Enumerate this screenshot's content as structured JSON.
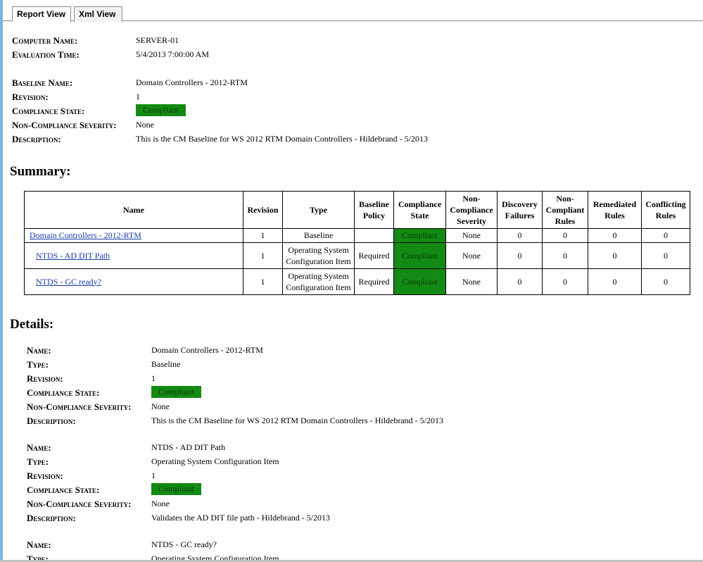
{
  "tabs": [
    {
      "label": "Report View"
    },
    {
      "label": "Xml View"
    }
  ],
  "header": {
    "computer_name_label": "Computer Name:",
    "computer_name": "SERVER-01",
    "evaluation_time_label": "Evaluation Time:",
    "evaluation_time": "5/4/2013 7:00:00 AM"
  },
  "baseline": {
    "name_label": "Baseline Name:",
    "name": "Domain Controllers - 2012-RTM",
    "revision_label": "Revision:",
    "revision": "1",
    "state_label": "Compliance State:",
    "state": "Compliant",
    "severity_label": "Non-Compliance Severity:",
    "severity": "None",
    "description_label": "Description:",
    "description": "This is the CM Baseline for WS 2012 RTM Domain Controllers - Hildebrand - 5/2013"
  },
  "summary": {
    "heading": "Summary:",
    "columns": [
      "Name",
      "Revision",
      "Type",
      "Baseline Policy",
      "Compliance State",
      "Non-Compliance Severity",
      "Discovery Failures",
      "Non-Compliant Rules",
      "Remediated Rules",
      "Conflicting Rules"
    ],
    "rows": [
      {
        "name": "Domain Controllers - 2012-RTM",
        "revision": "1",
        "type": "Baseline",
        "policy": "",
        "state": "Compliant",
        "severity": "None",
        "discovery": "0",
        "noncompliant": "0",
        "remediated": "0",
        "conflicting": "0"
      },
      {
        "name": "NTDS - AD DIT Path",
        "revision": "1",
        "type": "Operating System Configuration Item",
        "policy": "Required",
        "state": "Compliant",
        "severity": "None",
        "discovery": "0",
        "noncompliant": "0",
        "remediated": "0",
        "conflicting": "0"
      },
      {
        "name": "NTDS - GC ready?",
        "revision": "1",
        "type": "Operating System Configuration Item",
        "policy": "Required",
        "state": "Compliant",
        "severity": "None",
        "discovery": "0",
        "noncompliant": "0",
        "remediated": "0",
        "conflicting": "0"
      }
    ]
  },
  "details": {
    "heading": "Details:",
    "labels": {
      "name": "Name:",
      "type": "Type:",
      "revision": "Revision:",
      "state": "Compliance State:",
      "severity": "Non-Compliance Severity:",
      "description": "Description:"
    },
    "items": [
      {
        "name": "Domain Controllers - 2012-RTM",
        "type": "Baseline",
        "revision": "1",
        "state": "Compliant",
        "severity": "None",
        "description": "This is the CM Baseline for WS 2012 RTM Domain Controllers - Hildebrand - 5/2013"
      },
      {
        "name": "NTDS - AD DIT Path",
        "type": "Operating System Configuration Item",
        "revision": "1",
        "state": "Compliant",
        "severity": "None",
        "description": "Validates the AD DIT file path - Hildebrand - 5/2013"
      },
      {
        "name": "NTDS - GC ready?",
        "type": "Operating System Configuration Item"
      }
    ]
  },
  "colors": {
    "compliant": "#138a13",
    "link": "#1a3aa8"
  }
}
